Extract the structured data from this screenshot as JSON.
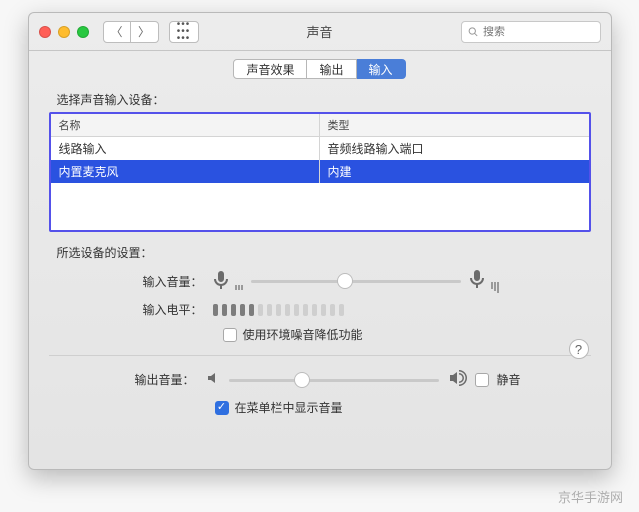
{
  "window": {
    "title": "声音",
    "search_placeholder": "搜索"
  },
  "tabs": [
    {
      "label": "声音效果",
      "active": false
    },
    {
      "label": "输出",
      "active": false
    },
    {
      "label": "输入",
      "active": true
    }
  ],
  "input_section": {
    "heading": "选择声音输入设备：",
    "columns": {
      "name": "名称",
      "type": "类型"
    },
    "devices": [
      {
        "name": "线路输入",
        "type": "音频线路输入端口",
        "selected": false
      },
      {
        "name": "内置麦克风",
        "type": "内建",
        "selected": true
      }
    ]
  },
  "settings": {
    "heading": "所选设备的设置：",
    "input_volume": {
      "label": "输入音量：",
      "value": 0.45
    },
    "input_level": {
      "label": "输入电平：",
      "lit": 5,
      "total": 15
    },
    "noise_reduction": {
      "label": "使用环境噪音降低功能",
      "checked": false
    }
  },
  "output": {
    "volume": {
      "label": "输出音量：",
      "value": 0.35
    },
    "mute": {
      "label": "静音",
      "checked": false
    },
    "show_in_menubar": {
      "label": "在菜单栏中显示音量",
      "checked": true
    }
  },
  "watermark": "京华手游网"
}
